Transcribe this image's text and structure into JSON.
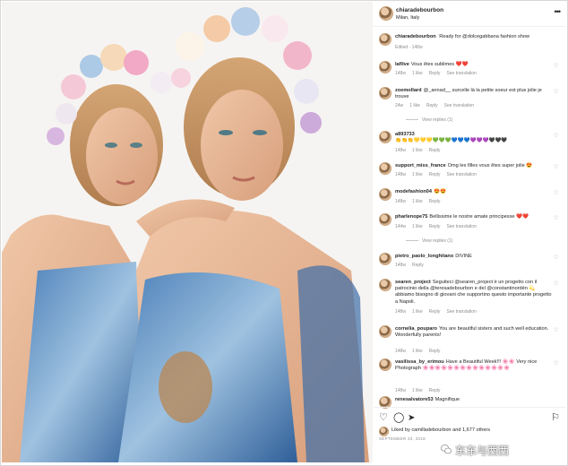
{
  "post": {
    "username": "chiaradebourbon",
    "location": "Milan, Italy",
    "more_label": "•••"
  },
  "caption": {
    "username": "chiaradebourbon",
    "text": "Ready for @dolcegabbana fashion show",
    "edited": "Edited · 148w"
  },
  "comments": [
    {
      "user": "lafilve",
      "text": "Vous êtes sublimes ❤️❤️",
      "meta": [
        "148w",
        "1 like",
        "Reply",
        "See translation"
      ]
    },
    {
      "user": "zoemollard",
      "text": "@_annad__ surcelle là la petite soeur est plus jolie je trouve",
      "meta": [
        "24w",
        "1 like",
        "Reply",
        "See translation"
      ],
      "view_replies": "View replies (1)"
    },
    {
      "user": "a893733",
      "text": "👏👏👏💛💛💛💚💚💚💙💙💙💜💜💜🖤🖤🖤",
      "meta": [
        "148w",
        "1 like",
        "Reply"
      ]
    },
    {
      "user": "support_miss_france",
      "text": "Omg les filles vous êtes super jolie 😍",
      "meta": [
        "148w",
        "1 like",
        "Reply",
        "See translation"
      ]
    },
    {
      "user": "modefashion04",
      "text": "😍😍",
      "meta": [
        "148w",
        "1 like",
        "Reply"
      ]
    },
    {
      "user": "pharlenope75",
      "text": "Bellissime le nostre amate principesse ❤️❤️",
      "meta": [
        "144w",
        "1 like",
        "Reply",
        "See translation"
      ],
      "view_replies": "View replies (1)"
    },
    {
      "user": "pietro_paolo_longhitano",
      "text": "DIVINE",
      "meta": [
        "148w",
        "Reply"
      ]
    },
    {
      "user": "searen_project",
      "text": "Seguiteci @searen_project è un progetto con il patrocinio della @teresadebourbon e del @constantinordén 💫 abbiamo bisogno di giovani che supportino questo importante progetto a Napoli.",
      "meta": [
        "148w",
        "1 like",
        "Reply",
        "See translation"
      ]
    },
    {
      "user": "cornelia_pouparo",
      "text": "You are beautiful sisters and such well education. Wonderfully parents!",
      "meta": [
        "148w",
        "1 like",
        "Reply"
      ]
    },
    {
      "user": "vasilissa_by_erimou",
      "text": "Have a Beautiful Week!!! 🌸🌸 Very nice Photograph 🌸🌸🌸🌸🌸🌸🌸🌸🌸🌸🌸🌸🌸🌸",
      "meta": [
        "148w",
        "1 like",
        "Reply"
      ]
    },
    {
      "user": "renesalvatore53",
      "text": "Magnifique",
      "meta": []
    }
  ],
  "actions": {
    "likes_text": "Liked by camilladebourbon and 1,677 others",
    "date": "SEPTEMBER 20, 2018"
  },
  "watermark": "东东与西西",
  "colors": {
    "text": "#262626",
    "meta": "#8e8e8e",
    "heart_red": "#ed4956"
  }
}
